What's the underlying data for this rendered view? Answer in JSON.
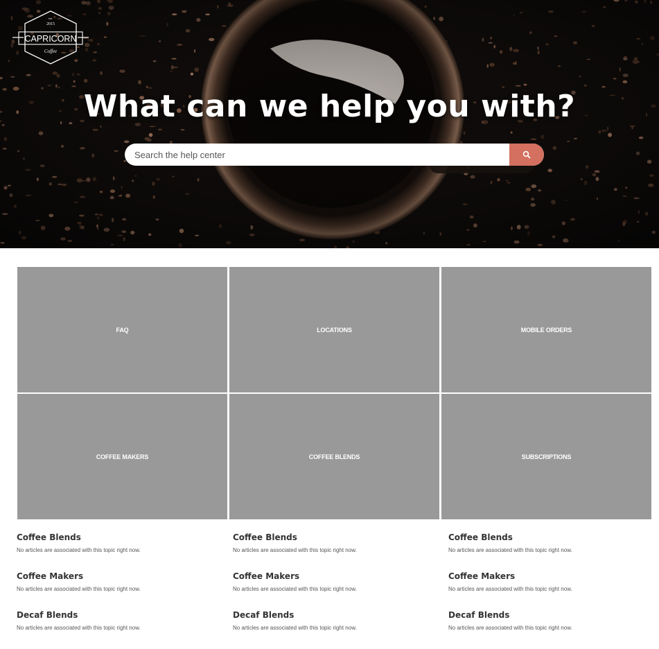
{
  "brand": {
    "est": "est.",
    "year": "2015",
    "name": "CAPRICORN",
    "tagline": "Coffee"
  },
  "hero": {
    "title": "What can we help you with?"
  },
  "search": {
    "placeholder": "Search the help center",
    "button_icon": "search-icon",
    "button_color": "#d3705f"
  },
  "categories": [
    {
      "label": "FAQ"
    },
    {
      "label": "LOCATIONS"
    },
    {
      "label": "MOBILE ORDERS"
    },
    {
      "label": "COFFEE MAKERS"
    },
    {
      "label": "COFFEE BLENDS"
    },
    {
      "label": "SUBSCRIPTIONS"
    }
  ],
  "sections": [
    {
      "topics": [
        {
          "title": "Coffee Blends",
          "empty": "No articles are associated with this topic right now."
        },
        {
          "title": "Coffee Makers",
          "empty": "No articles are associated with this topic right now."
        },
        {
          "title": "Decaf Blends",
          "empty": "No articles are associated with this topic right now."
        }
      ]
    },
    {
      "topics": [
        {
          "title": "Coffee Blends",
          "empty": "No articles are associated with this topic right now."
        },
        {
          "title": "Coffee Makers",
          "empty": "No articles are associated with this topic right now."
        },
        {
          "title": "Decaf Blends",
          "empty": "No articles are associated with this topic right now."
        }
      ]
    },
    {
      "topics": [
        {
          "title": "Coffee Blends",
          "empty": "No articles are associated with this topic right now."
        },
        {
          "title": "Coffee Makers",
          "empty": "No articles are associated with this topic right now."
        },
        {
          "title": "Decaf Blends",
          "empty": "No articles are associated with this topic right now."
        }
      ]
    }
  ],
  "colors": {
    "tile_bg": "#999999",
    "accent": "#d3705f",
    "hero_bg": "#0c0a09"
  }
}
